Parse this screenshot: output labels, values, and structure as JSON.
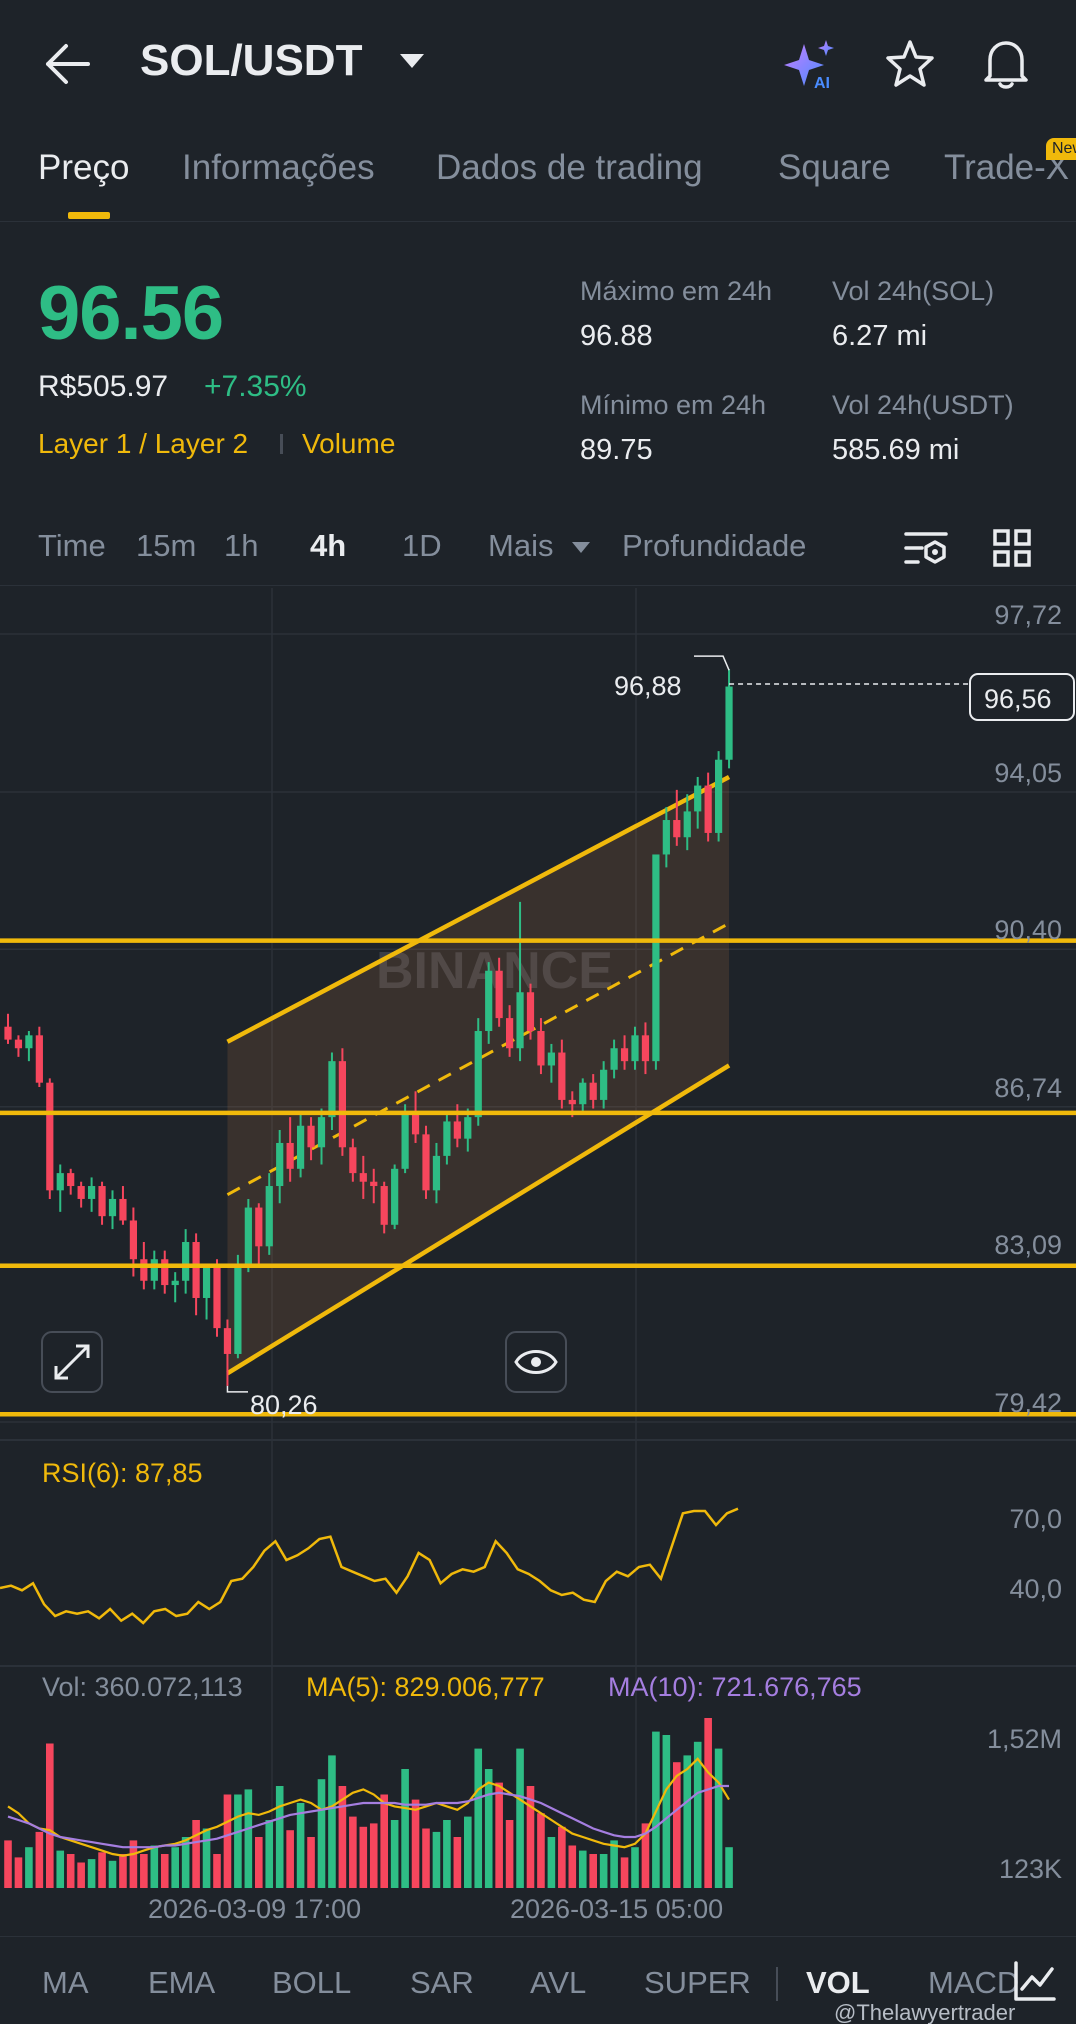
{
  "header": {
    "pair": "SOL/USDT"
  },
  "tabs": [
    {
      "label": "Preço"
    },
    {
      "label": "Informações"
    },
    {
      "label": "Dados de trading"
    },
    {
      "label": "Square"
    },
    {
      "label": "Trade-X"
    }
  ],
  "new_badge": "New",
  "ticker": {
    "price": "96.56",
    "fiat": "R$505.97",
    "change": "+7.35%",
    "tag1": "Layer 1 / Layer 2",
    "tag2": "Volume",
    "high_label": "Máximo em 24h",
    "high_value": "96.88",
    "low_label": "Mínimo em 24h",
    "low_value": "89.75",
    "vol_sol_label": "Vol 24h(SOL)",
    "vol_sol_value": "6.27 mi",
    "vol_usdt_label": "Vol 24h(USDT)",
    "vol_usdt_value": "585.69 mi"
  },
  "intervals": [
    "Time",
    "15m",
    "1h",
    "4h",
    "1D",
    "Mais",
    "Profundidade"
  ],
  "chart_labels": {
    "watermark": "BINANCE",
    "high_marker": "96,88",
    "low_marker": "80,26",
    "last_price": "96,56",
    "rsi": "RSI(6): 87,85",
    "vol": "Vol: 360.072,113",
    "ma5": "MA(5): 829.006,777",
    "ma10": "MA(10): 721.676,765",
    "time1": "2026-03-09 17:00",
    "time2": "2026-03-15 05:00"
  },
  "colors": {
    "up": "#2ebd85",
    "down": "#f6465d",
    "accent": "#f0b90b",
    "ma10": "#a57ee0"
  },
  "chart_data": {
    "type": "candlestick",
    "price_axis": [
      "97,72",
      "94,05",
      "90,40",
      "86,74",
      "83,09",
      "79,42"
    ],
    "price_axis_values": [
      97.72,
      94.05,
      90.4,
      86.74,
      83.09,
      79.42
    ],
    "rsi_axis": [
      "70,0",
      "40,0"
    ],
    "rsi_axis_values": [
      70,
      40
    ],
    "volume_axis": [
      "1,52M",
      "123K"
    ],
    "volume_axis_values": [
      1520000,
      123000
    ],
    "horizontal_levels": [
      90.6,
      86.6,
      83.05,
      79.6
    ],
    "channel": {
      "upper": {
        "from": [
          9,
          88.25
        ],
        "to": [
          57,
          94.4
        ]
      },
      "mid": {
        "from": [
          9,
          84.7
        ],
        "to": [
          57,
          91.0
        ]
      },
      "lower": {
        "from": [
          9,
          80.55
        ],
        "to": [
          57,
          87.7
        ]
      }
    },
    "candles": [
      [
        88.6,
        88.9,
        88.2,
        88.3
      ],
      [
        88.3,
        88.4,
        87.9,
        88.1
      ],
      [
        88.1,
        88.5,
        87.8,
        88.4
      ],
      [
        88.4,
        88.6,
        87.2,
        87.3
      ],
      [
        87.3,
        87.4,
        84.6,
        84.8
      ],
      [
        84.8,
        85.4,
        84.3,
        85.2
      ],
      [
        85.2,
        85.3,
        84.7,
        84.9
      ],
      [
        84.9,
        85.0,
        84.4,
        84.6
      ],
      [
        84.6,
        85.1,
        84.3,
        84.9
      ],
      [
        84.9,
        85.0,
        84.0,
        84.2
      ],
      [
        84.2,
        84.8,
        83.9,
        84.6
      ],
      [
        84.6,
        84.9,
        84.0,
        84.1
      ],
      [
        84.1,
        84.4,
        82.8,
        83.2
      ],
      [
        83.2,
        83.6,
        82.5,
        82.7
      ],
      [
        82.7,
        83.4,
        82.5,
        83.2
      ],
      [
        83.2,
        83.4,
        82.4,
        82.6
      ],
      [
        82.6,
        82.9,
        82.2,
        82.7
      ],
      [
        82.7,
        83.9,
        82.4,
        83.6
      ],
      [
        83.6,
        83.8,
        81.9,
        82.3
      ],
      [
        82.3,
        83.1,
        81.8,
        83.0
      ],
      [
        83.0,
        83.2,
        81.4,
        81.6
      ],
      [
        81.6,
        81.8,
        80.26,
        81.0
      ],
      [
        81.0,
        83.3,
        80.9,
        83.1
      ],
      [
        83.1,
        84.6,
        82.9,
        84.4
      ],
      [
        84.4,
        84.5,
        83.1,
        83.5
      ],
      [
        83.5,
        85.2,
        83.3,
        84.9
      ],
      [
        84.9,
        86.2,
        84.5,
        85.9
      ],
      [
        85.9,
        86.5,
        85.0,
        85.3
      ],
      [
        85.3,
        86.6,
        85.1,
        86.3
      ],
      [
        86.3,
        86.5,
        85.5,
        85.8
      ],
      [
        85.8,
        86.7,
        85.4,
        86.5
      ],
      [
        86.5,
        88.0,
        86.2,
        87.8
      ],
      [
        87.8,
        88.1,
        85.6,
        85.8
      ],
      [
        85.8,
        86.0,
        85.0,
        85.2
      ],
      [
        85.2,
        85.6,
        84.6,
        85.0
      ],
      [
        85.0,
        85.3,
        84.5,
        84.9
      ],
      [
        84.9,
        85.0,
        83.8,
        84.0
      ],
      [
        84.0,
        85.4,
        83.9,
        85.3
      ],
      [
        85.3,
        86.8,
        85.2,
        86.6
      ],
      [
        86.6,
        87.1,
        85.9,
        86.1
      ],
      [
        86.1,
        86.3,
        84.6,
        84.8
      ],
      [
        84.8,
        85.9,
        84.5,
        85.6
      ],
      [
        85.6,
        86.6,
        85.4,
        86.4
      ],
      [
        86.4,
        86.8,
        85.8,
        86.0
      ],
      [
        86.0,
        86.7,
        85.7,
        86.5
      ],
      [
        86.5,
        88.8,
        86.3,
        88.5
      ],
      [
        88.5,
        90.1,
        88.2,
        89.9
      ],
      [
        89.9,
        90.2,
        88.6,
        88.8
      ],
      [
        88.8,
        89.1,
        87.9,
        88.1
      ],
      [
        88.1,
        91.5,
        87.8,
        89.4
      ],
      [
        89.4,
        89.6,
        88.3,
        88.5
      ],
      [
        88.5,
        88.8,
        87.5,
        87.7
      ],
      [
        87.7,
        88.2,
        87.3,
        88.0
      ],
      [
        88.0,
        88.3,
        86.7,
        86.9
      ],
      [
        86.9,
        87.1,
        86.5,
        86.8
      ],
      [
        86.8,
        87.4,
        86.6,
        87.3
      ],
      [
        87.3,
        87.5,
        86.7,
        86.9
      ],
      [
        86.9,
        87.8,
        86.7,
        87.6
      ],
      [
        87.6,
        88.3,
        87.4,
        88.1
      ],
      [
        88.1,
        88.4,
        87.6,
        87.8
      ],
      [
        87.8,
        88.6,
        87.6,
        88.4
      ],
      [
        88.4,
        88.7,
        87.5,
        87.8
      ],
      [
        87.8,
        90.6,
        87.6,
        92.6
      ],
      [
        92.6,
        93.7,
        92.3,
        93.4
      ],
      [
        93.4,
        94.1,
        92.8,
        93.0
      ],
      [
        93.0,
        94.0,
        92.7,
        93.6
      ],
      [
        93.6,
        94.4,
        93.2,
        94.2
      ],
      [
        94.2,
        94.5,
        92.9,
        93.1
      ],
      [
        93.1,
        95.0,
        92.9,
        94.8
      ],
      [
        94.8,
        96.9,
        94.6,
        96.5
      ]
    ],
    "rsi": [
      40,
      41,
      39,
      42,
      33,
      28,
      30,
      29,
      30,
      27,
      31,
      26,
      29,
      25,
      30,
      31,
      28,
      29,
      34,
      31,
      34,
      43,
      44,
      49,
      56,
      60,
      52,
      54,
      57,
      61,
      62,
      49,
      47,
      45,
      43,
      44,
      38,
      45,
      55,
      52,
      42,
      46,
      48,
      47,
      49,
      60,
      55,
      48,
      46,
      43,
      39,
      37,
      38,
      35,
      34,
      43,
      47,
      45,
      49,
      50,
      44,
      58,
      72,
      73,
      73,
      67,
      72,
      74
    ],
    "volume": [
      0.28,
      0.18,
      0.24,
      0.33,
      0.85,
      0.22,
      0.2,
      0.15,
      0.17,
      0.21,
      0.16,
      0.2,
      0.28,
      0.2,
      0.25,
      0.2,
      0.24,
      0.3,
      0.4,
      0.35,
      0.2,
      0.55,
      0.55,
      0.58,
      0.3,
      0.4,
      0.6,
      0.34,
      0.5,
      0.3,
      0.64,
      0.78,
      0.6,
      0.42,
      0.36,
      0.38,
      0.55,
      0.4,
      0.7,
      0.52,
      0.35,
      0.33,
      0.4,
      0.3,
      0.42,
      0.82,
      0.7,
      0.62,
      0.4,
      0.82,
      0.6,
      0.44,
      0.3,
      0.36,
      0.25,
      0.22,
      0.2,
      0.2,
      0.28,
      0.18,
      0.24,
      0.38,
      0.92,
      0.9,
      0.74,
      0.78,
      0.86,
      1.0,
      0.82,
      0.24
    ],
    "ma5": [
      0.48,
      0.44,
      0.38,
      0.35,
      0.34,
      0.3,
      0.28,
      0.26,
      0.24,
      0.22,
      0.2,
      0.19,
      0.2,
      0.22,
      0.24,
      0.25,
      0.26,
      0.28,
      0.31,
      0.34,
      0.36,
      0.39,
      0.42,
      0.44,
      0.43,
      0.45,
      0.48,
      0.5,
      0.52,
      0.5,
      0.46,
      0.48,
      0.52,
      0.56,
      0.58,
      0.55,
      0.5,
      0.48,
      0.47,
      0.46,
      0.48,
      0.5,
      0.48,
      0.46,
      0.5,
      0.58,
      0.62,
      0.6,
      0.56,
      0.52,
      0.48,
      0.44,
      0.4,
      0.36,
      0.32,
      0.3,
      0.28,
      0.26,
      0.25,
      0.24,
      0.26,
      0.32,
      0.45,
      0.58,
      0.66,
      0.7,
      0.76,
      0.68,
      0.62,
      0.52
    ],
    "ma10": [
      0.42,
      0.4,
      0.38,
      0.35,
      0.32,
      0.3,
      0.29,
      0.28,
      0.27,
      0.26,
      0.25,
      0.24,
      0.24,
      0.24,
      0.24,
      0.25,
      0.25,
      0.26,
      0.27,
      0.28,
      0.29,
      0.31,
      0.33,
      0.35,
      0.37,
      0.39,
      0.41,
      0.43,
      0.44,
      0.45,
      0.46,
      0.47,
      0.48,
      0.49,
      0.5,
      0.5,
      0.5,
      0.5,
      0.49,
      0.49,
      0.49,
      0.5,
      0.5,
      0.5,
      0.51,
      0.53,
      0.55,
      0.56,
      0.55,
      0.54,
      0.52,
      0.5,
      0.47,
      0.44,
      0.41,
      0.38,
      0.35,
      0.33,
      0.31,
      0.3,
      0.3,
      0.32,
      0.36,
      0.41,
      0.46,
      0.51,
      0.56,
      0.58,
      0.6,
      0.6
    ]
  },
  "indicators": [
    "MA",
    "EMA",
    "BOLL",
    "SAR",
    "AVL",
    "SUPER",
    "VOL",
    "MACD"
  ],
  "watermark_text": "@Thelawyertrader"
}
